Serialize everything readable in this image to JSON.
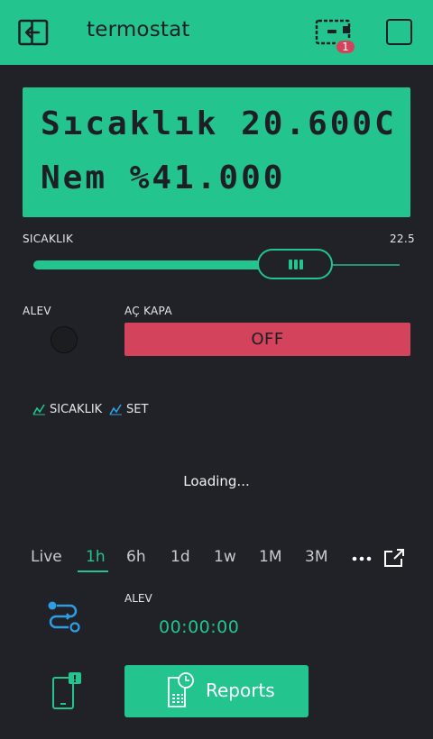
{
  "header": {
    "title": "termostat",
    "badge_count": "1"
  },
  "lcd": {
    "line1": "Sıcaklık 20.600C",
    "line2": "Nem %41.000"
  },
  "slider": {
    "label": "SICAKLIK",
    "value_label": "22.5",
    "fill_fraction": 0.66
  },
  "led": {
    "label": "ALEV",
    "state": "off"
  },
  "switch": {
    "label": "AÇ KAPA",
    "button_text": "OFF"
  },
  "chart": {
    "legend": [
      {
        "name": "SICAKLIK"
      },
      {
        "name": "SET"
      }
    ],
    "loading_text": "Loading...",
    "ranges": [
      "Live",
      "1h",
      "6h",
      "1d",
      "1w",
      "1M",
      "3M"
    ],
    "active_range": "1h"
  },
  "timer_widget": {
    "label": "ALEV",
    "value": "00:00:00"
  },
  "reports": {
    "button_text": "Reports"
  },
  "colors": {
    "accent": "#23c48e",
    "background": "#212227",
    "danger": "#d3435c",
    "set_series": "#2d9ee6"
  },
  "icons": {
    "back": "exit-icon",
    "device": "device-icon",
    "square": "menu-square-icon",
    "legend": "line-chart-icon",
    "more": "more-dots-icon",
    "expand": "expand-icon",
    "control": "eventor-icon",
    "notify": "notification-icon",
    "reports": "reports-icon"
  }
}
